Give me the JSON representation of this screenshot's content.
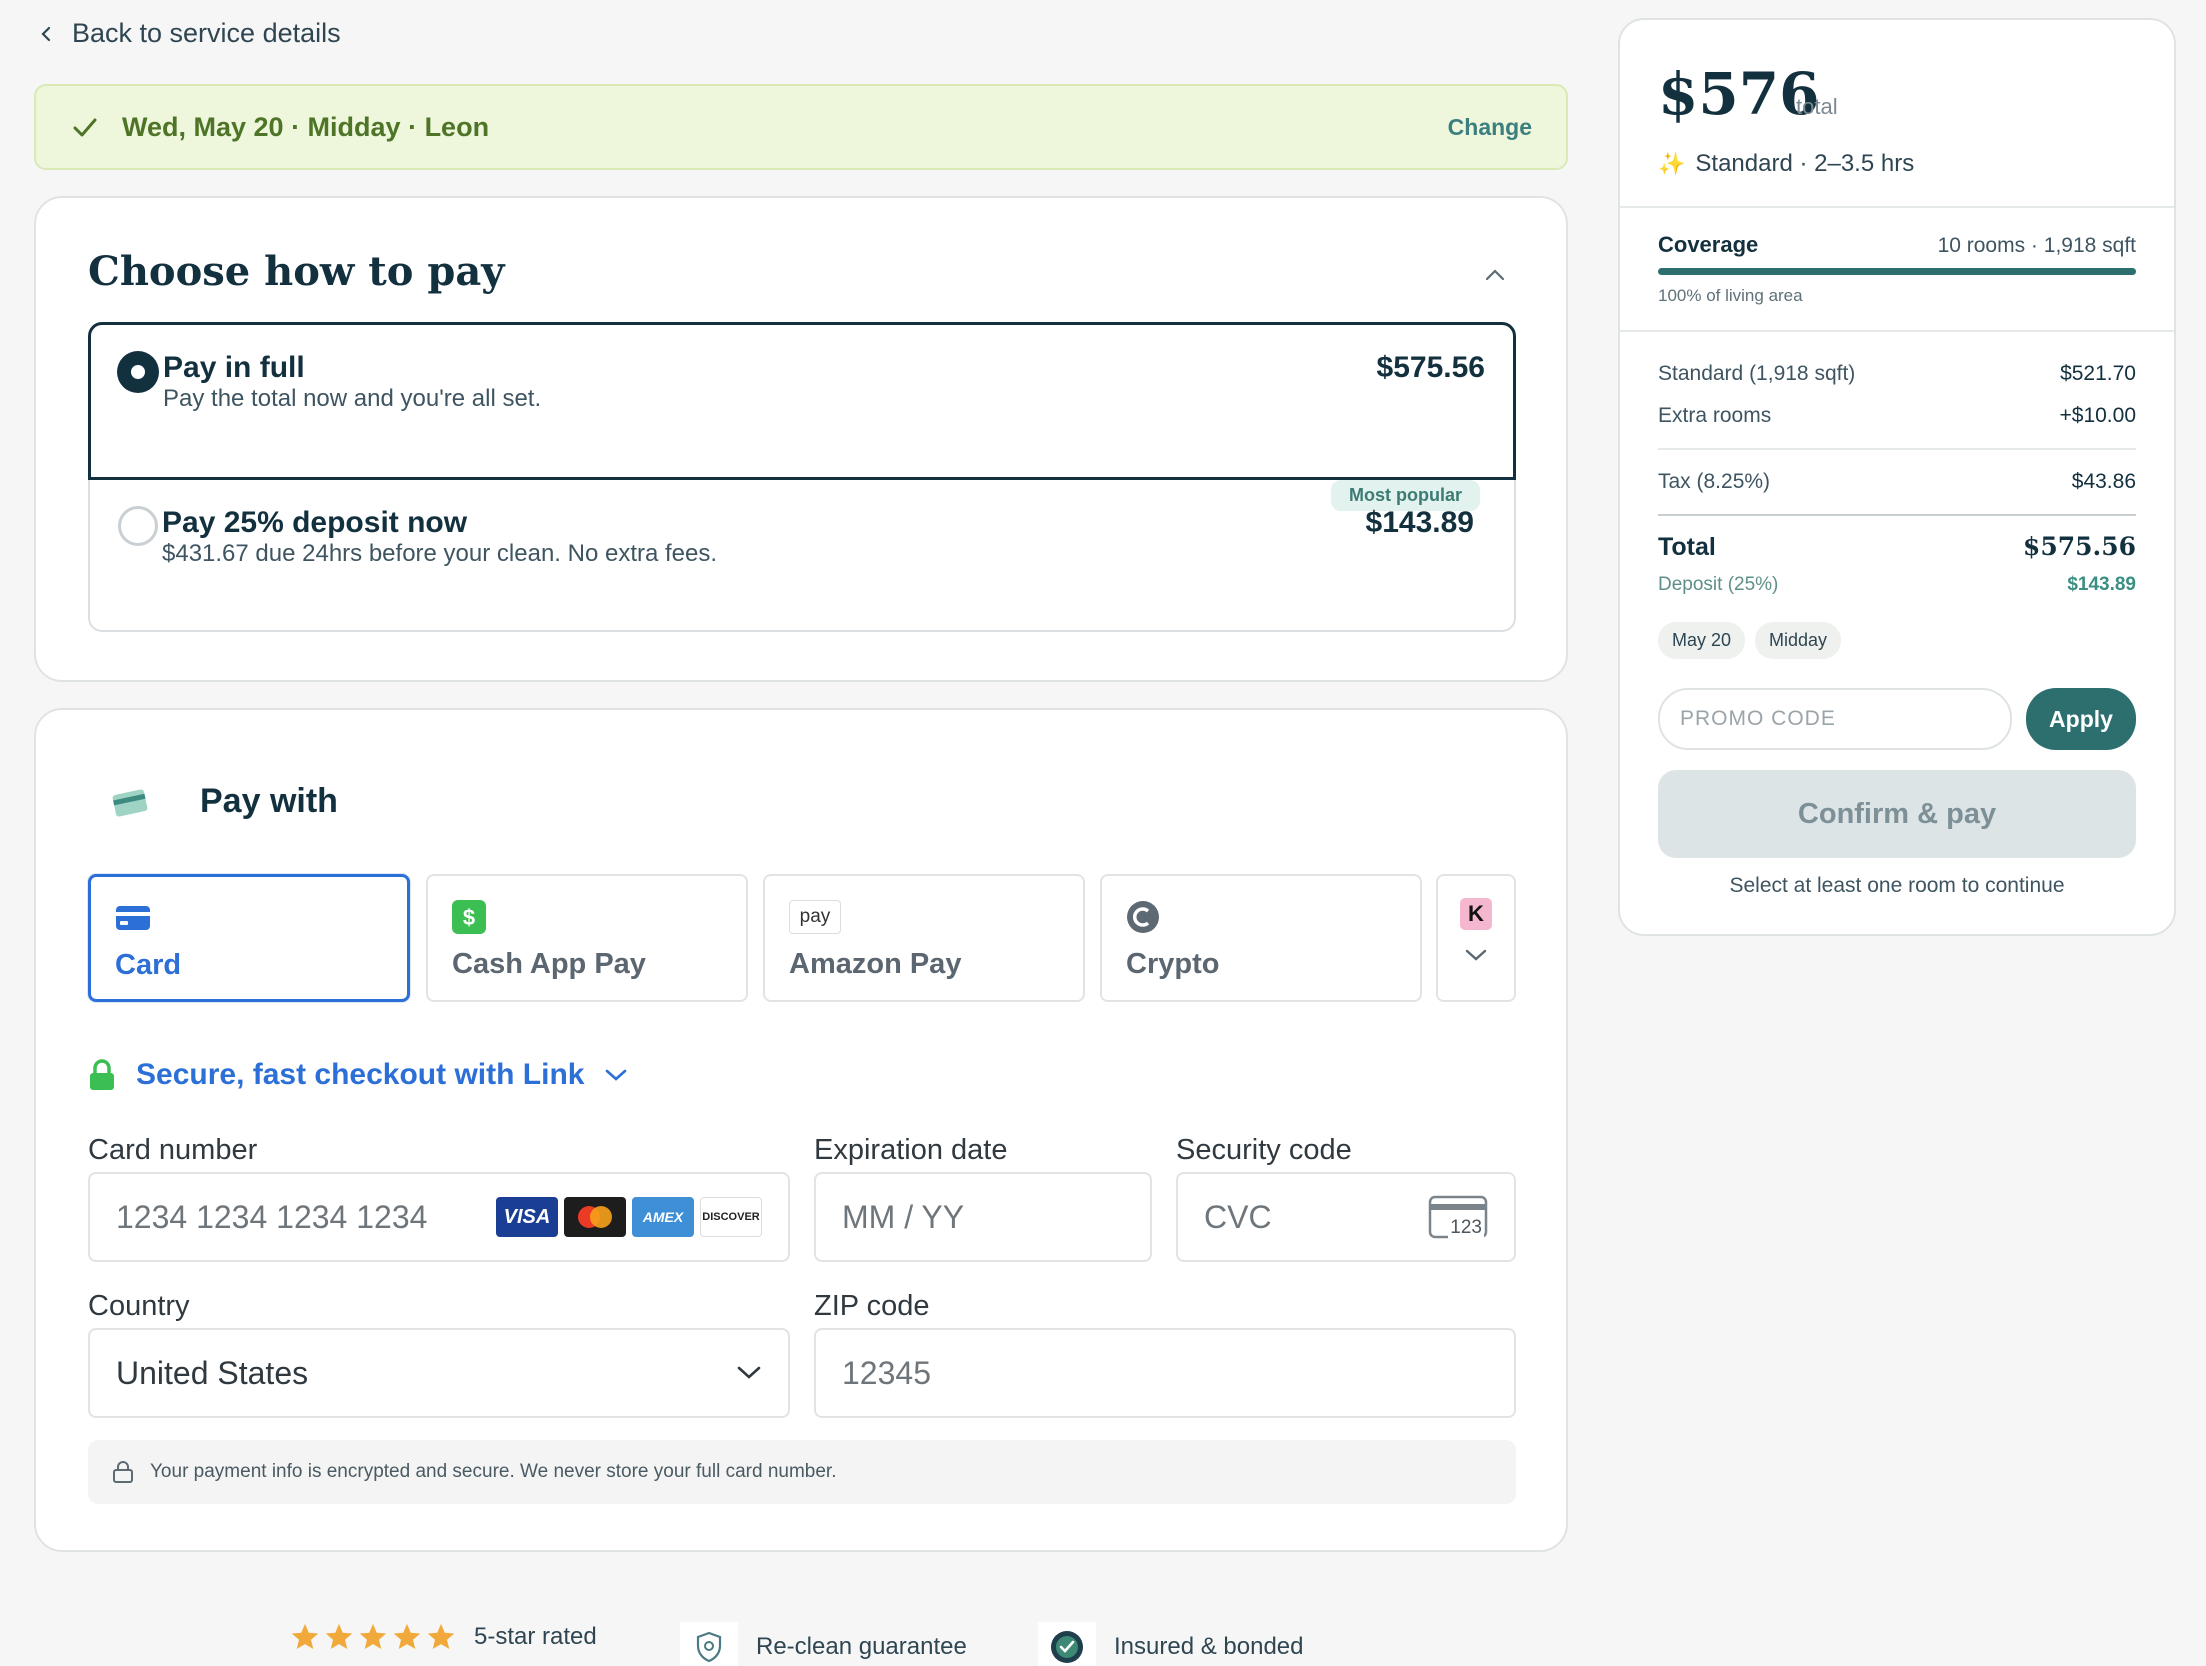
{
  "nav": {
    "back_label": "Back to service details"
  },
  "banner": {
    "text": "Wed, May 20 · Midday · Leon",
    "change_label": "Change"
  },
  "payment_plan": {
    "title": "Choose how to pay",
    "options": [
      {
        "label": "Pay in full",
        "description": "Pay the total now and you're all set.",
        "price": "$575.56",
        "selected": true
      },
      {
        "label": "Pay 25% deposit now",
        "description": "$431.67 due 24hrs before your clean. No extra fees.",
        "price": "$143.89",
        "badge": "Most popular",
        "selected": false
      }
    ]
  },
  "pay_with": {
    "title": "Pay with",
    "methods": [
      {
        "label": "Card",
        "icon": "card-icon",
        "active": true
      },
      {
        "label": "Cash App Pay",
        "icon": "cash-app-icon",
        "active": false
      },
      {
        "label": "Amazon Pay",
        "icon": "amazon-pay-icon",
        "icon_text": "pay",
        "active": false
      },
      {
        "label": "Crypto",
        "icon": "crypto-icon",
        "active": false
      },
      {
        "label": "",
        "icon": "klarna-icon",
        "icon_text": "K",
        "active": false
      }
    ],
    "link_text": "Secure, fast checkout with Link",
    "fields": {
      "card_number": {
        "label": "Card number",
        "placeholder": "1234 1234 1234 1234",
        "brands": [
          "VISA",
          "Mastercard",
          "AMEX",
          "DISCOVER"
        ]
      },
      "expiry": {
        "label": "Expiration date",
        "placeholder": "MM / YY"
      },
      "cvc": {
        "label": "Security code",
        "placeholder": "CVC",
        "icon_text": "123"
      },
      "country": {
        "label": "Country",
        "value": "United States"
      },
      "zip": {
        "label": "ZIP code",
        "placeholder": "12345"
      }
    },
    "secure_note": "Your payment info is encrypted and secure. We never store your full card number."
  },
  "trust": [
    {
      "label": "5-star rated",
      "icon": "star-icon"
    },
    {
      "label": "Re-clean guarantee",
      "icon": "shield-icon"
    },
    {
      "label": "Insured & bonded",
      "icon": "badge-check-icon"
    }
  ],
  "summary": {
    "total": "$576",
    "total_suffix": "total",
    "tier": "Standard · 2–3.5 hrs",
    "coverage": {
      "label": "Coverage",
      "value": "10 rooms · 1,918 sqft",
      "caption": "100% of living area",
      "percent": 100
    },
    "lines": [
      {
        "label": "Standard (1,918 sqft)",
        "amount": "$521.70"
      },
      {
        "label": "Extra rooms",
        "amount": "+$10.00"
      },
      {
        "label": "Tax (8.25%)",
        "amount": "$43.86"
      }
    ],
    "grand_total": {
      "label": "Total",
      "amount": "$575.56"
    },
    "deposit": {
      "label": "Deposit (25%)",
      "amount": "$143.89"
    },
    "chips": [
      "May 20",
      "Midday"
    ],
    "promo_placeholder": "PROMO CODE",
    "apply_label": "Apply",
    "confirm_label": "Confirm & pay",
    "hint": "Select at least one room to continue"
  },
  "colors": {
    "accent": "#2d6f6f",
    "link_blue": "#2c6fd6",
    "navy": "#13303e",
    "banner_bg": "#eef6dc"
  }
}
